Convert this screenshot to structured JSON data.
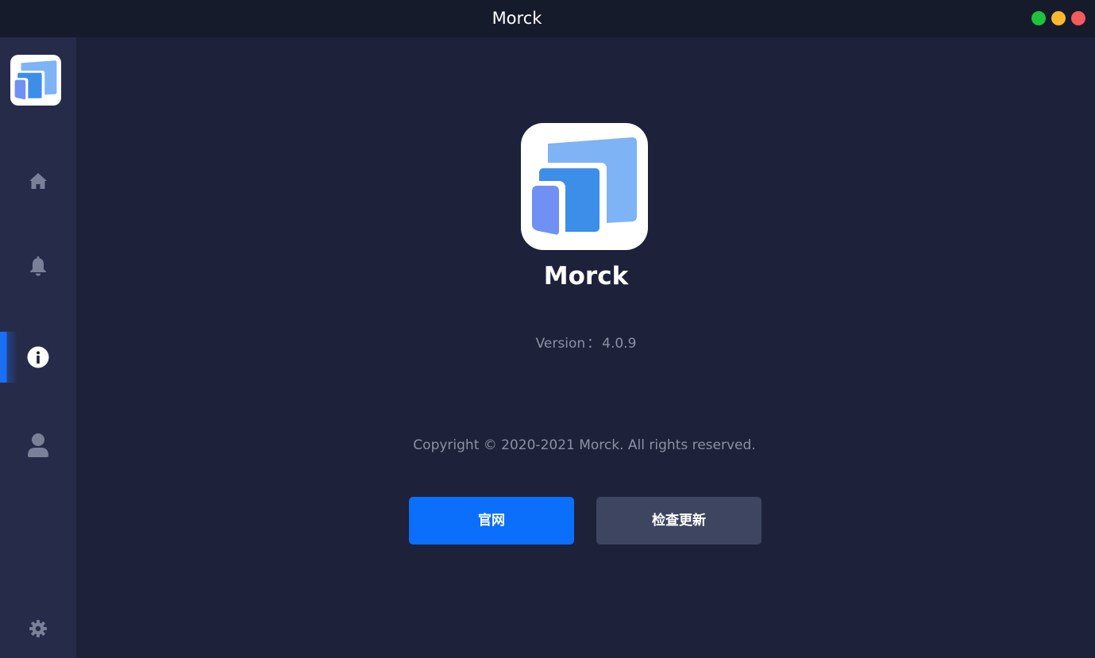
{
  "window": {
    "title": "Morck",
    "controls": [
      "maximize",
      "minimize",
      "close"
    ]
  },
  "colors": {
    "background": "#1d2139",
    "sidebar": "#272b4a",
    "titlebar": "#161b2c",
    "accent": "#0b6ffc",
    "secondary_button": "#3e4560",
    "muted_text": "#8d91a3",
    "nav_icon": "#7a8097"
  },
  "sidebar": {
    "logo": "morck-logo",
    "items": [
      {
        "icon": "home-icon",
        "active": false
      },
      {
        "icon": "bell-icon",
        "active": false
      },
      {
        "icon": "info-icon",
        "active": true
      },
      {
        "icon": "user-icon",
        "active": false
      }
    ],
    "settings_icon": "gear-icon"
  },
  "about": {
    "app_name": "Morck",
    "version_label": "Version",
    "version_separator": "：",
    "version_value": "4.0.9",
    "copyright": "Copyright © 2020-2021 Morck. All rights reserved.",
    "website_button": "官网",
    "check_update_button": "检查更新"
  }
}
